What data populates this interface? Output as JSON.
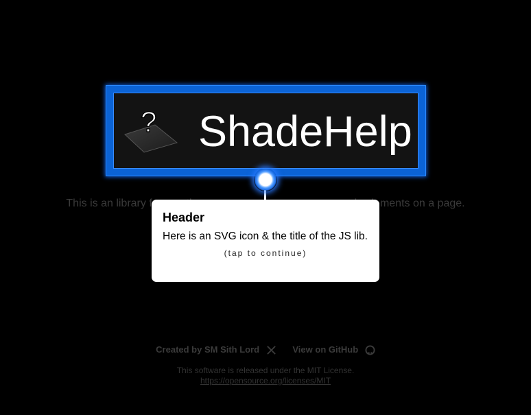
{
  "header": {
    "title": "ShadeHelp"
  },
  "tagline": {
    "left_visible": "This is an library for creati",
    "right_visible": "eneric elements on a page."
  },
  "tooltip": {
    "title": "Header",
    "body": "Here is an SVG icon & the title of the JS lib.",
    "cta": "(tap to continue)"
  },
  "footer": {
    "created_by": "Created by SM Sith Lord",
    "github": "View on GitHub",
    "license_text": "This software is released under the MIT License.",
    "license_url": "https://opensource.org/licenses/MIT"
  },
  "colors": {
    "highlight_border": "#0b63d6",
    "glow": "#2b89ff",
    "background": "#000000",
    "tooltip_bg": "#ffffff"
  },
  "icons": {
    "logo": "question-mark-on-tilted-plane-icon",
    "x": "x-logo-icon",
    "github": "github-logo-icon"
  }
}
